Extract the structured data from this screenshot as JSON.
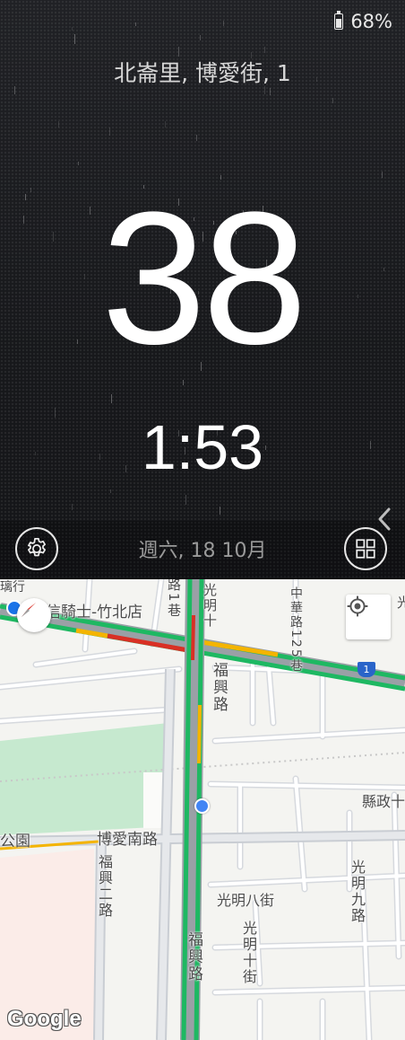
{
  "status": {
    "battery": "68%",
    "battery_level": 0.68
  },
  "dashboard": {
    "address": "北崙里, 博愛街, 1",
    "speed": "38",
    "time": "1:53",
    "date": "週六, 18 10月"
  },
  "icons": {
    "settings": "gear-icon",
    "apps": "grid-icon",
    "expand": "chevron-left-icon",
    "locate": "my-location-icon",
    "compass": "compass-icon"
  },
  "map": {
    "labels": {
      "top_left_cut": "璃行",
      "poi": "宏信騎士-竹北店",
      "road_1_lane": "路1巷",
      "guangming_lane": "光明十",
      "zhonghua_lane": "中華路125巷",
      "fuxing_north": "福興路",
      "county_road": "縣政十",
      "park": "公園",
      "boai_south": "博愛南路",
      "fuxing_2": "福興二路",
      "guangming_8": "光明八街",
      "guangming_9": "光明九路",
      "guangming_10": "光明十街",
      "fuxing_south": "福興路",
      "route_badge": "1",
      "guang_edge": "光"
    },
    "logo": "Google"
  },
  "colors": {
    "traffic_green": "#1eb862",
    "traffic_yellow": "#f4b400",
    "traffic_red": "#d93025",
    "park_green": "#c6e9cf",
    "accent_blue": "#4285f4"
  }
}
